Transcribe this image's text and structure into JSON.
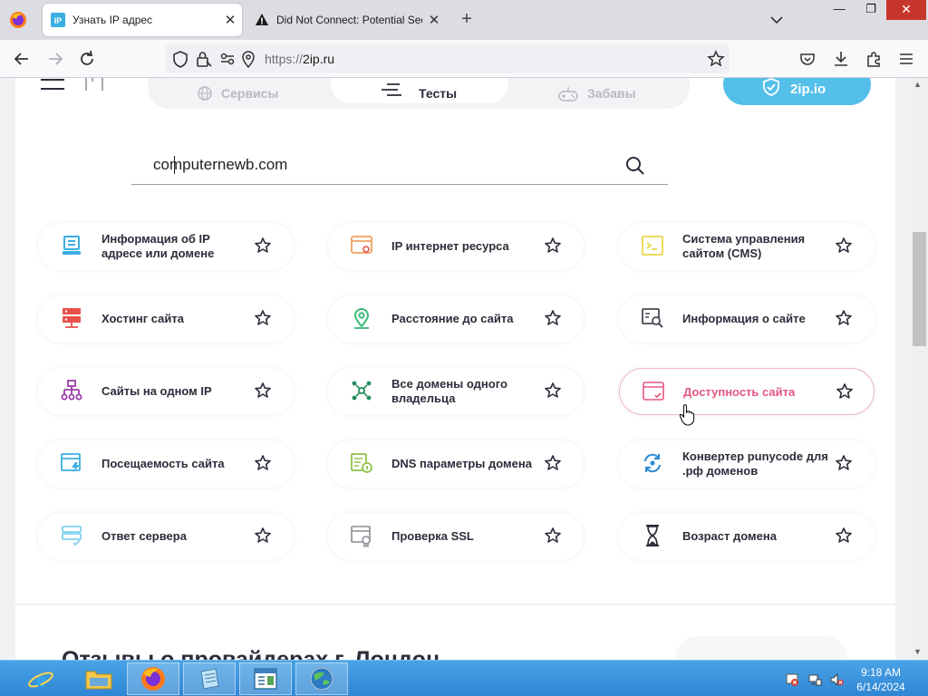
{
  "browser": {
    "tabs": [
      {
        "title": "Узнать IP адрес",
        "favicon": "ip-favicon",
        "active": true
      },
      {
        "title": "Did Not Connect: Potential Sec",
        "favicon": "warning-icon",
        "active": false
      }
    ],
    "url_proto": "https://",
    "url_host": "2ip.ru"
  },
  "site": {
    "nav": {
      "services": "Сервисы",
      "tests": "Тесты",
      "fun": "Забавы",
      "cta": "2ip.io"
    },
    "search": {
      "value": "computernewb.com"
    },
    "tiles": [
      {
        "label": "Информация об IP адресе или домене",
        "icon": "server-info-icon",
        "color": "#3aaee0"
      },
      {
        "label": "IP интернет ресурса",
        "icon": "browser-ip-icon",
        "color": "#f0a060"
      },
      {
        "label": "Система управления сайтом (CMS)",
        "icon": "terminal-icon",
        "color": "#e6d84a"
      },
      {
        "label": "Хостинг сайта",
        "icon": "hosting-icon",
        "color": "#e8504a"
      },
      {
        "label": "Расстояние до сайта",
        "icon": "map-pin-icon",
        "color": "#3cba78"
      },
      {
        "label": "Информация о сайте",
        "icon": "site-search-icon",
        "color": "#4a4a55"
      },
      {
        "label": "Сайты на одном IP",
        "icon": "sitemap-icon",
        "color": "#9a3fa8"
      },
      {
        "label": "Все домены одного владельца",
        "icon": "network-icon",
        "color": "#1f8e5a"
      },
      {
        "label": "Доступность сайта",
        "icon": "browser-check-icon",
        "color": "#e5577e",
        "active": true
      },
      {
        "label": "Посещаемость сайта",
        "icon": "traffic-icon",
        "color": "#3aaee0"
      },
      {
        "label": "DNS параметры домена",
        "icon": "dns-icon",
        "color": "#8cc34a"
      },
      {
        "label": "Конвертер punycode для .рф доменов",
        "icon": "convert-icon",
        "color": "#2a8ad4"
      },
      {
        "label": "Ответ сервера",
        "icon": "server-response-icon",
        "color": "#7fd0ee"
      },
      {
        "label": "Проверка SSL",
        "icon": "ssl-icon",
        "color": "#8a8a95"
      },
      {
        "label": "Возраст домена",
        "icon": "hourglass-icon",
        "color": "#2c2c3a"
      }
    ],
    "reviews_title": "Отзывы о провайдерах г. Лондон"
  },
  "taskbar": {
    "time": "9:18 AM",
    "date": "6/14/2024"
  }
}
